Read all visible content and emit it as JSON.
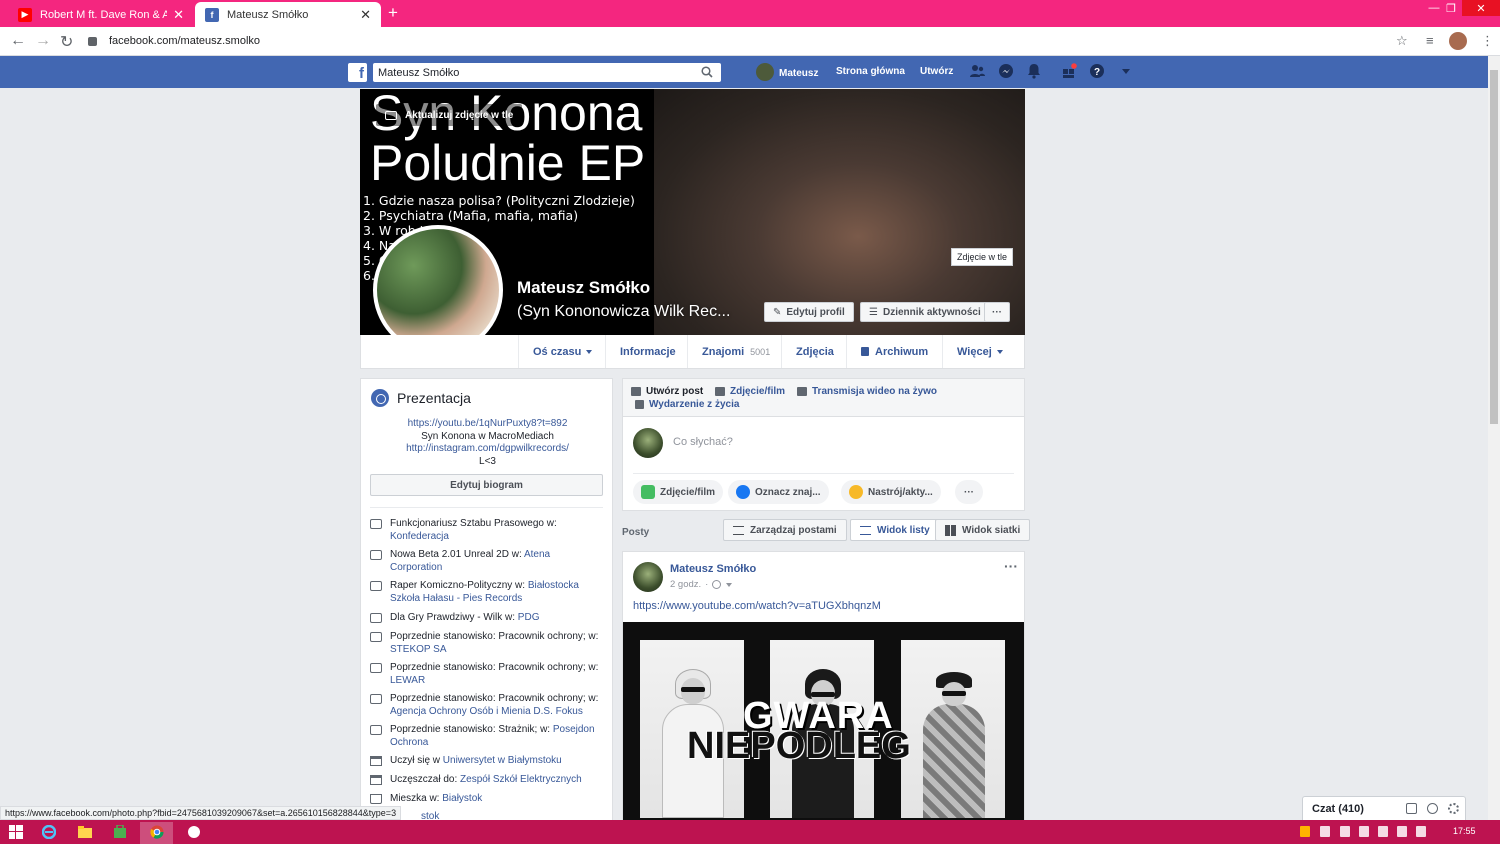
{
  "browser": {
    "tabs": [
      {
        "title": "Robert M ft. Dave Ron & Ar...",
        "favicon": "youtube-icon",
        "active": false
      },
      {
        "title": "Mateusz Smółko",
        "favicon": "facebook-icon",
        "active": true
      }
    ],
    "address": "facebook.com/mateusz.smolko",
    "status_url": "https://www.facebook.com/photo.php?fbid=2475681039209067&set=a.265610156828844&type=3",
    "colors": {
      "tabstrip": "#f4267f",
      "taskbar": "#bd1350"
    }
  },
  "fb_header": {
    "search_value": "Mateusz Smółko",
    "user_name": "Mateusz",
    "home": "Strona główna",
    "create": "Utwórz",
    "brand_color": "#4267b2"
  },
  "cover": {
    "update_cover_label": "Aktualizuj zdjęcie w tle",
    "ep_line1": "Syn Konona",
    "ep_line2": "Poludnie EP",
    "tracks": [
      "1. Gdzie nasza polisa? (Polityczni Zlodzieje)",
      "2. Psychiatra (Mafia, mafia, mafia)",
      "3. W rob         Job",
      "4. Na                Mysle",
      "5. C                  ery",
      "6.                     bory"
    ],
    "tooltip": "Zdjęcie w tle",
    "name": "Mateusz Smółko",
    "alt_name": "(Syn Kononowicza Wilk Rec...",
    "edit_profile": "Edytuj profil",
    "activity_log": "Dziennik aktywności",
    "more": "···"
  },
  "profile_nav": {
    "timeline": "Oś czasu",
    "about": "Informacje",
    "friends": "Znajomi",
    "friends_count": "5001",
    "photos": "Zdjęcia",
    "archive": "Archiwum",
    "more": "Więcej"
  },
  "intro": {
    "title": "Prezentacja",
    "bio": [
      {
        "text": "https://youtu.be/1qNurPuxty8?t=892",
        "link": true
      },
      {
        "text": "Syn Konona w MacroMediach",
        "link": false
      },
      {
        "text": "http://instagram.com/dgpwilkrecords/",
        "link": true
      },
      {
        "text": "L<3",
        "link": false
      }
    ],
    "edit_bio": "Edytuj biogram",
    "items": [
      {
        "icon": "work-icon",
        "text": "Funkcjonariusz Sztabu Prasowego w: ",
        "link": "Konfederacja"
      },
      {
        "icon": "work-icon",
        "text": "Nowa Beta 2.01 Unreal 2D w: ",
        "link": "Atena Corporation"
      },
      {
        "icon": "work-icon",
        "text": "Raper Komiczno-Polityczny w: ",
        "link": "Białostocka Szkoła Hałasu - Pies Records"
      },
      {
        "icon": "work-icon",
        "text": "Dla Gry Prawdziwy - Wilk w: ",
        "link": "PDG"
      },
      {
        "icon": "work-icon",
        "text": "Poprzednie stanowisko: Pracownik ochrony; w: ",
        "link": "STEKOP SA"
      },
      {
        "icon": "work-icon",
        "text": "Poprzednie stanowisko: Pracownik ochrony; w: ",
        "link": "LEWAR"
      },
      {
        "icon": "work-icon",
        "text": "Poprzednie stanowisko: Pracownik ochrony; w: ",
        "link": "Agencja Ochrony Osób i Mienia D.S. Fokus"
      },
      {
        "icon": "work-icon",
        "text": "Poprzednie stanowisko: Strażnik; w: ",
        "link": "Posejdon Ochrona"
      },
      {
        "icon": "school-icon",
        "text": "Uczył się w ",
        "link": "Uniwersytet w Białymstoku"
      },
      {
        "icon": "school-icon",
        "text": "Uczęszczał do: ",
        "link": "Zespół Szkół Elektrycznych"
      },
      {
        "icon": "home-icon",
        "text": "Mieszka w: ",
        "link": "Białystok"
      }
    ],
    "cut_link": "stok"
  },
  "composer": {
    "create_post": "Utwórz post",
    "photo_video": "Zdjęcie/film",
    "live_video": "Transmisja wideo na żywo",
    "life_event": "Wydarzenie z życia",
    "placeholder": "Co słychać?",
    "chip_photo": "Zdjęcie/film",
    "chip_tag": "Oznacz znaj...",
    "chip_feeling": "Nastrój/akty...",
    "chip_more": "···"
  },
  "posts_header": {
    "label": "Posty",
    "manage": "Zarządzaj postami",
    "list_view": "Widok listy",
    "grid_view": "Widok siatki"
  },
  "post": {
    "author": "Mateusz Smółko",
    "time": "2 godz.",
    "dot": "·",
    "more": "···",
    "link": "https://www.youtube.com/watch?v=aTUGXbhqnzM",
    "image_text1": "GWARA",
    "image_text2": "NIEPODLEG"
  },
  "chat": {
    "label": "Czat (410)"
  },
  "taskbar": {
    "clock": "17:55"
  }
}
